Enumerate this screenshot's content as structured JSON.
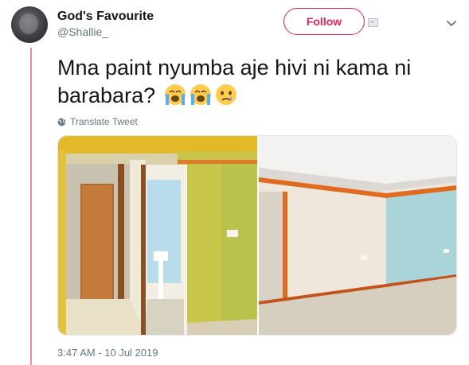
{
  "tweet": {
    "display_name": "God's Favourite",
    "handle": "@Shallie_",
    "text": "Mna paint nyumba aje hivi ni kama ni barabara?",
    "emojis": [
      "loudly-crying-face",
      "loudly-crying-face",
      "crying-face"
    ],
    "translate_label": "Translate Tweet",
    "timestamp": "3:47 AM - 10 Jul 2019"
  },
  "actions": {
    "follow_label": "Follow"
  },
  "media": {
    "photos": [
      {
        "description_icon": "room-photo-yellow-walls"
      },
      {
        "description_icon": "room-photo-orange-trim"
      }
    ]
  },
  "colors": {
    "follow_accent": "#e0245e",
    "thread_line": "#f08c8c",
    "secondary_text": "#657786",
    "primary_text": "#14171a"
  }
}
